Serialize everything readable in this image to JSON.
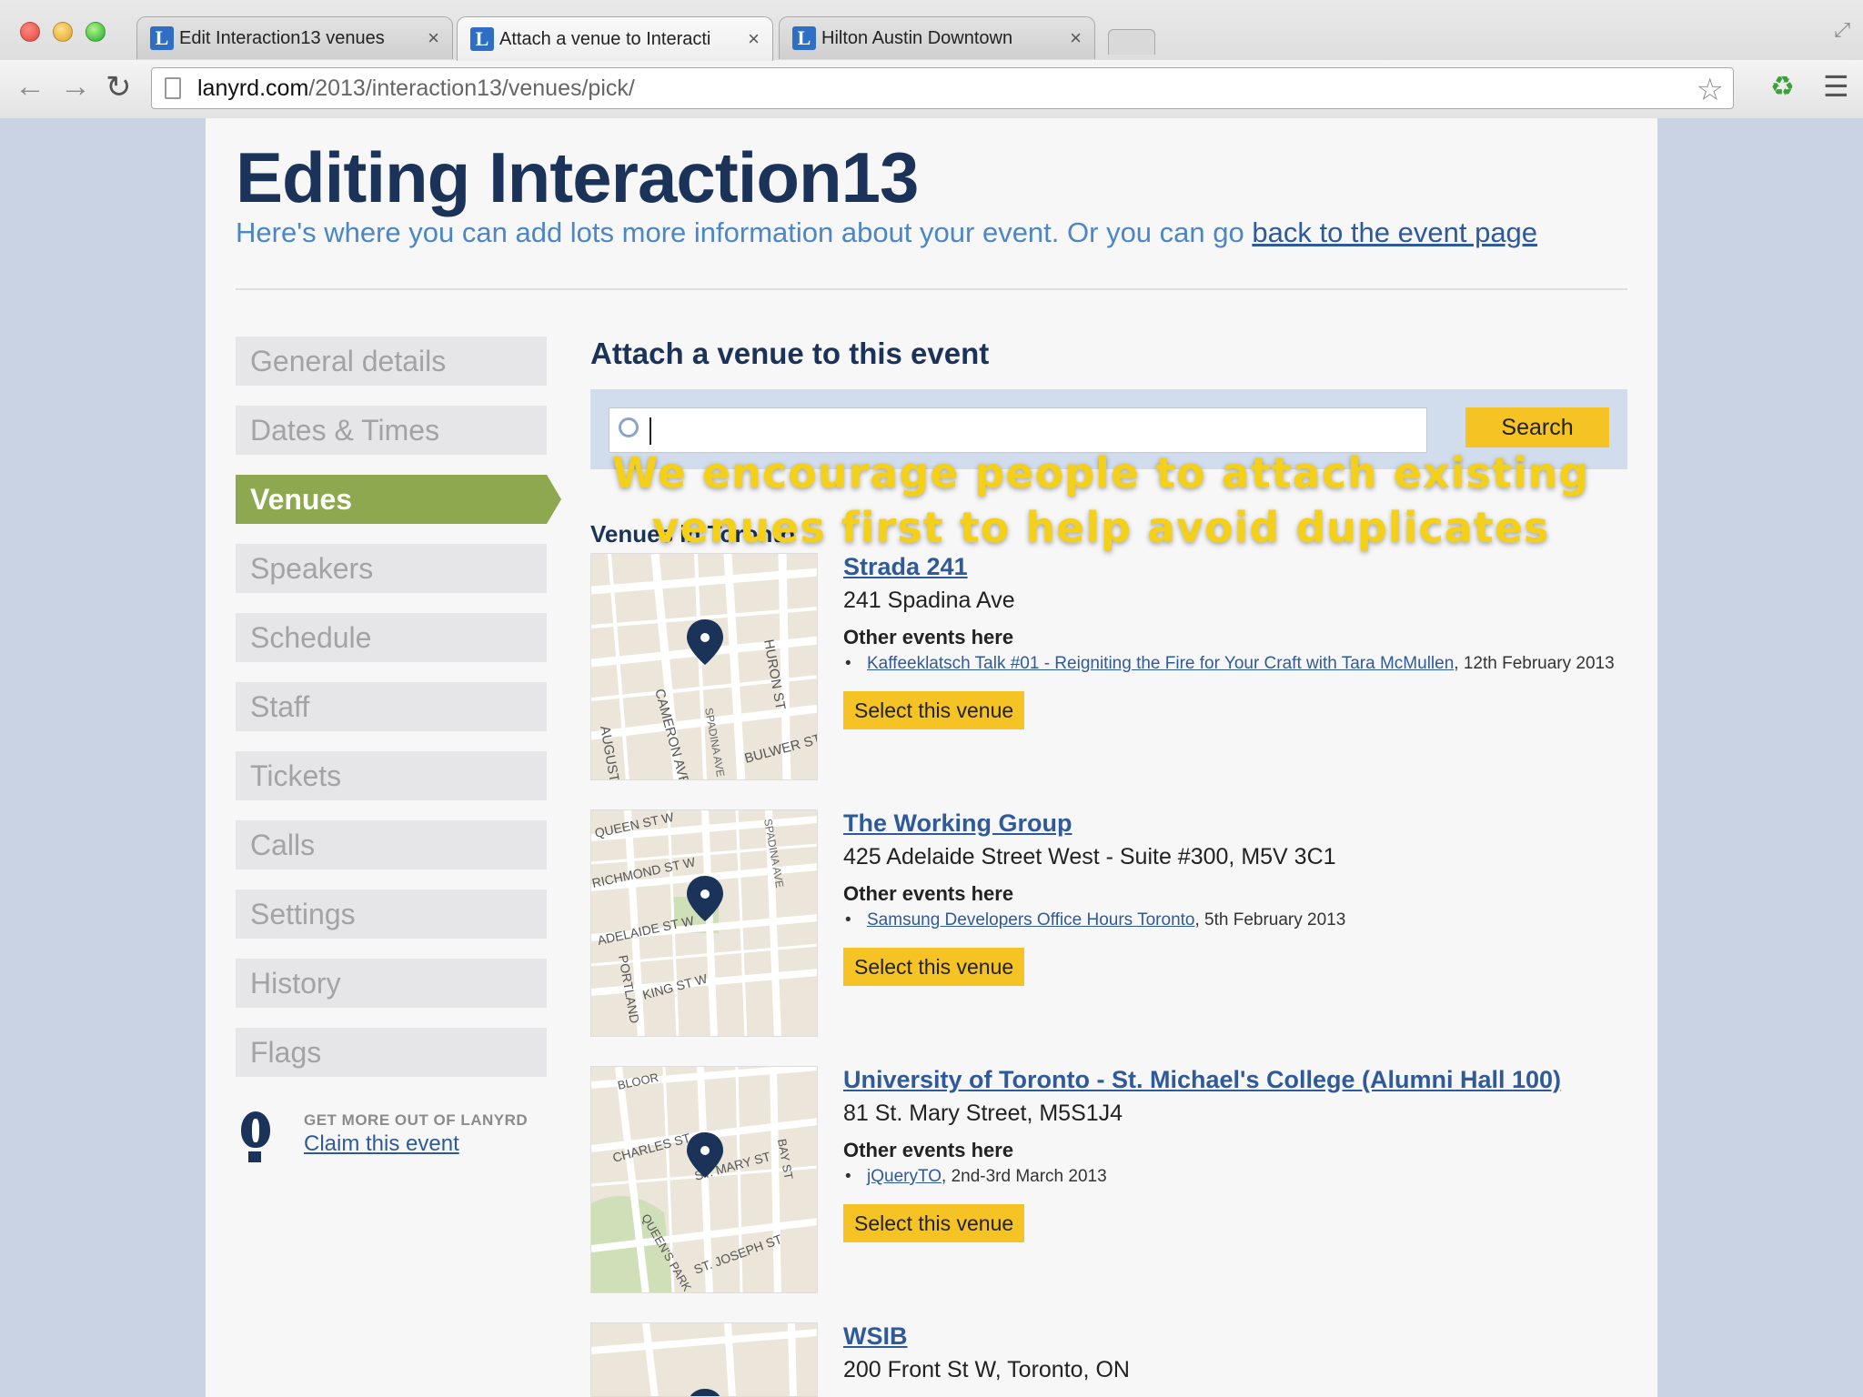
{
  "browser": {
    "tabs": [
      {
        "title": "Edit Interaction13 venues",
        "active": false
      },
      {
        "title": "Attach a venue to Interacti",
        "active": true
      },
      {
        "title": "Hilton Austin Downtown",
        "active": false
      }
    ],
    "url_host": "lanyrd.com",
    "url_path": "/2013/interaction13/venues/pick/"
  },
  "page": {
    "title": "Editing Interaction13",
    "subtitle": "Here's where you can add lots more information about your event. Or you can go ",
    "subtitle_link": "back to the event page"
  },
  "sidebar": {
    "items": [
      {
        "label": "General details"
      },
      {
        "label": "Dates & Times"
      },
      {
        "label": "Venues"
      },
      {
        "label": "Speakers"
      },
      {
        "label": "Schedule"
      },
      {
        "label": "Staff"
      },
      {
        "label": "Tickets"
      },
      {
        "label": "Calls"
      },
      {
        "label": "Settings"
      },
      {
        "label": "History"
      },
      {
        "label": "Flags"
      }
    ],
    "promo_label": "GET MORE OUT OF LANYRD",
    "promo_link": "Claim this event"
  },
  "main": {
    "section_title": "Attach a venue to this event",
    "search_button": "Search",
    "venues_heading": "Venues in Toronto",
    "other_events_label": "Other events here",
    "select_label": "Select this venue",
    "venues": [
      {
        "name": "Strada 241",
        "address": "241 Spadina Ave",
        "events": [
          {
            "link": "Kaffeeklatsch Talk #01 - Reigniting the Fire for Your Craft with Tara McMullen",
            "date": ", 12th February 2013"
          }
        ],
        "map_labels": [
          "HURON ST",
          "CAMERON AVE",
          "SPADINA AVE",
          "BULWER ST",
          "AUGUST"
        ]
      },
      {
        "name": "The Working Group",
        "address": "425 Adelaide Street West - Suite #300, M5V 3C1",
        "events": [
          {
            "link": "Samsung Developers Office Hours Toronto",
            "date": ", 5th February 2013"
          }
        ],
        "map_labels": [
          "QUEEN ST W",
          "RICHMOND ST W",
          "ADELAIDE ST W",
          "KING ST W",
          "PORTLAND",
          "SPADINA AVE"
        ]
      },
      {
        "name": "University of Toronto - St. Michael's College (Alumni Hall 100)",
        "address": "81 St. Mary Street, M5S1J4",
        "events": [
          {
            "link": "jQueryTO",
            "date": ", 2nd-3rd March 2013"
          }
        ],
        "map_labels": [
          "BLOOR",
          "CHARLES ST",
          "ST. MARY ST",
          "BAY ST",
          "QUEEN'S PARK",
          "ST. JOSEPH ST"
        ]
      },
      {
        "name": "WSIB",
        "address": "200 Front St W, Toronto, ON"
      }
    ]
  },
  "overlay": {
    "line1": "We encourage people to attach existing",
    "line2": "venues first to help avoid duplicates"
  },
  "colors": {
    "brand_navy": "#1b3358",
    "link_blue": "#2f5a9a",
    "active_green": "#8da84e",
    "button_yellow": "#f6c325",
    "caption_yellow": "#f4d019"
  }
}
